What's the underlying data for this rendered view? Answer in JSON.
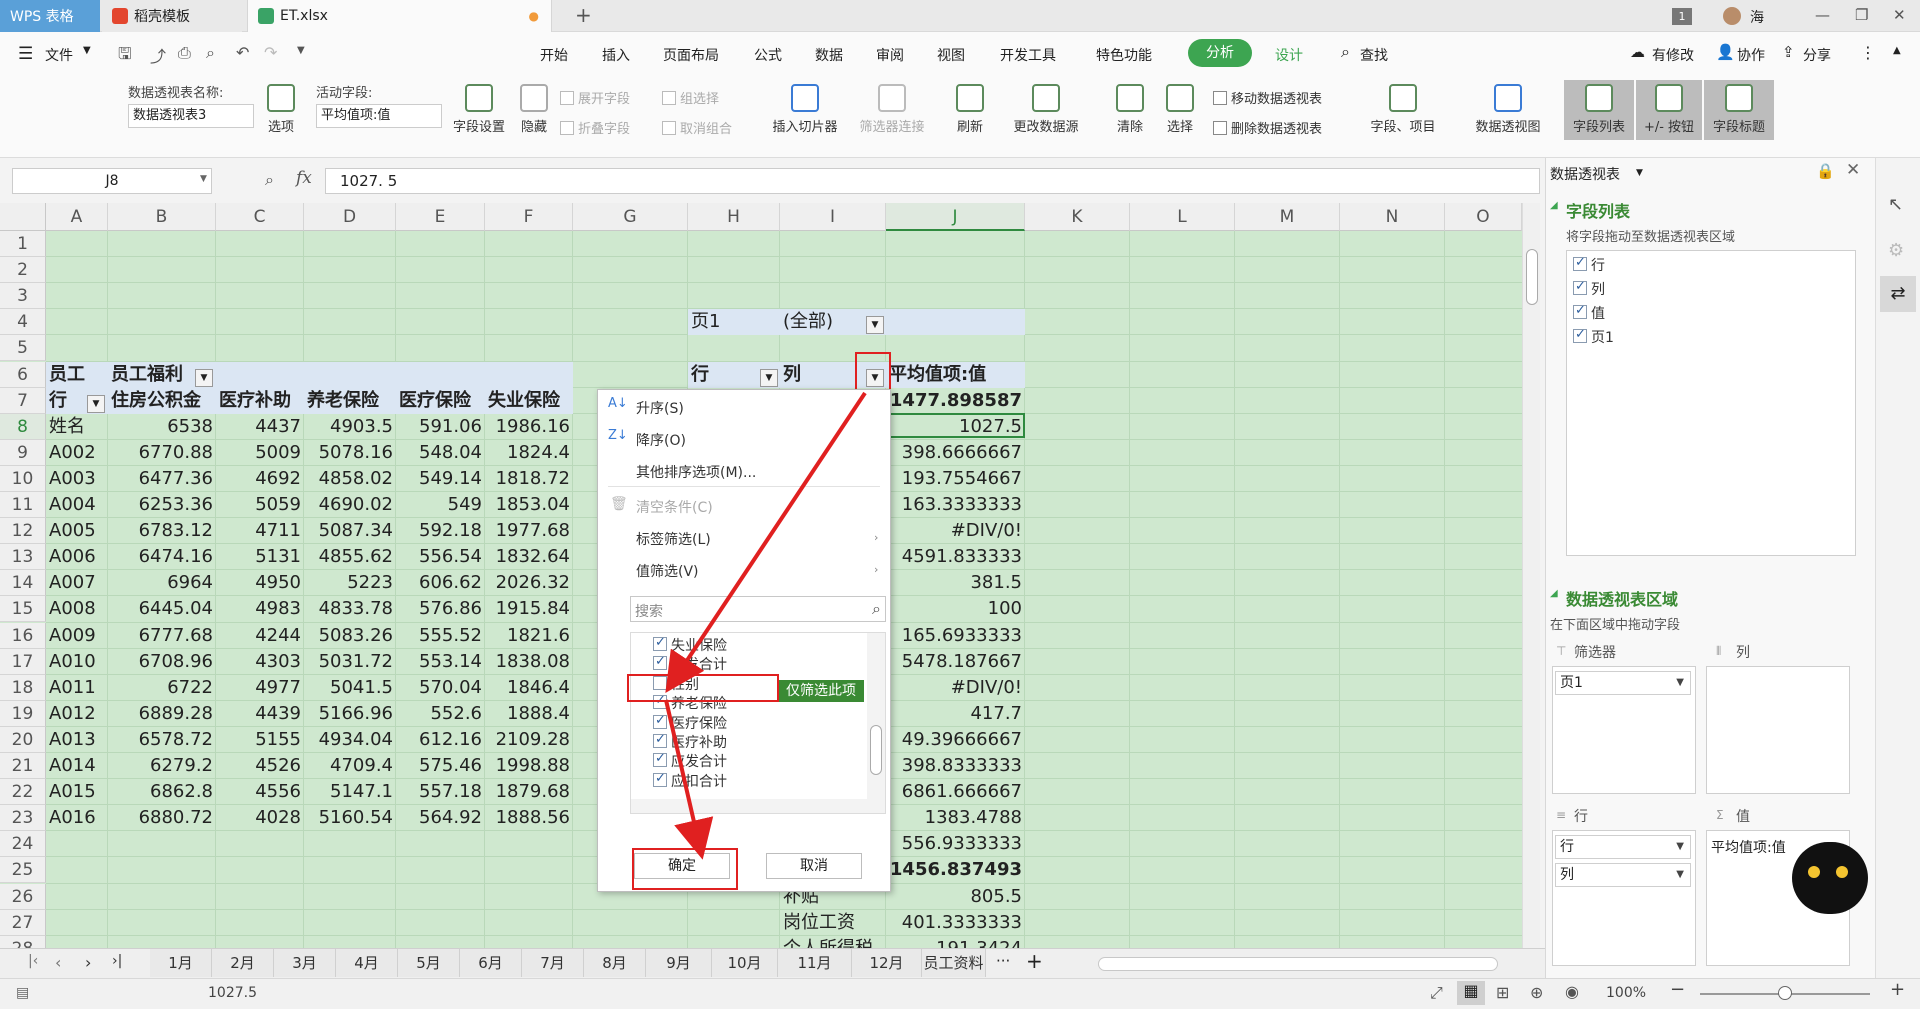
{
  "titlebar": {
    "tabs": [
      "WPS 表格",
      "稻壳模板",
      "ET.xlsx"
    ],
    "badge": "1",
    "user": "海"
  },
  "menubar": {
    "file": "文件",
    "items": [
      "开始",
      "插入",
      "页面布局",
      "公式",
      "数据",
      "审阅",
      "视图",
      "开发工具",
      "特色功能",
      "分析",
      "设计",
      "查找"
    ],
    "right": [
      "有修改",
      "协作",
      "分享"
    ]
  },
  "ribbon": {
    "name_label": "数据透视表名称:",
    "name_value": "数据透视表3",
    "options": "选项",
    "active_label": "活动字段:",
    "active_value": "平均值项:值",
    "field_settings": "字段设置",
    "hide": "隐藏",
    "expand": "展开字段",
    "collapse": "折叠字段",
    "group": "组选择",
    "ungroup": "取消组合",
    "slicer": "插入切片器",
    "filter_conn": "筛选器连接",
    "refresh": "刷新",
    "change_source": "更改数据源",
    "clear": "清除",
    "select": "选择",
    "move": "移动数据透视表",
    "delete": "删除数据透视表",
    "fields_items": "字段、项目",
    "pivot_chart": "数据透视图",
    "field_list": "字段列表",
    "buttons": "+/- 按钮",
    "field_headers": "字段标题"
  },
  "formula": {
    "cellref": "J8",
    "fx": "fx",
    "value": "1027. 5"
  },
  "grid": {
    "columns": [
      "A",
      "B",
      "C",
      "D",
      "E",
      "F",
      "G",
      "H",
      "I",
      "J",
      "K",
      "L",
      "M",
      "N",
      "O"
    ],
    "rows": [
      "1",
      "2",
      "3",
      "4",
      "5",
      "6",
      "7",
      "8",
      "9",
      "10",
      "11",
      "12",
      "13",
      "14",
      "15",
      "16",
      "17",
      "18",
      "19",
      "20",
      "21",
      "22",
      "23",
      "24",
      "25",
      "26",
      "27",
      "28"
    ],
    "page1_label": "页1",
    "page1_value": "(全部)",
    "left_headers": {
      "r6a": "员工",
      "r6b": "员工福利",
      "r7a": "行",
      "r7b": "住房公积金",
      "r7c": "医疗补助",
      "r7d": "养老保险",
      "r7e": "医疗保险",
      "r7f": "失业保险"
    },
    "left_rows": [
      [
        "姓名",
        "6538",
        "4437",
        "4903.5",
        "591.06",
        "1986.16"
      ],
      [
        "A002",
        "6770.88",
        "5009",
        "5078.16",
        "548.04",
        "1824.4"
      ],
      [
        "A003",
        "6477.36",
        "4692",
        "4858.02",
        "549.14",
        "1818.72"
      ],
      [
        "A004",
        "6253.36",
        "5059",
        "4690.02",
        "549",
        "1853.04"
      ],
      [
        "A005",
        "6783.12",
        "4711",
        "5087.34",
        "592.18",
        "1977.68"
      ],
      [
        "A006",
        "6474.16",
        "5131",
        "4855.62",
        "556.54",
        "1832.64"
      ],
      [
        "A007",
        "6964",
        "4950",
        "5223",
        "606.62",
        "2026.32"
      ],
      [
        "A008",
        "6445.04",
        "4983",
        "4833.78",
        "576.86",
        "1915.84"
      ],
      [
        "A009",
        "6777.68",
        "4244",
        "5083.26",
        "555.52",
        "1821.6"
      ],
      [
        "A010",
        "6708.96",
        "4303",
        "5031.72",
        "553.14",
        "1838.08"
      ],
      [
        "A011",
        "6722",
        "4977",
        "5041.5",
        "570.04",
        "1846.4"
      ],
      [
        "A012",
        "6889.28",
        "4439",
        "5166.96",
        "552.6",
        "1888.4"
      ],
      [
        "A013",
        "6578.72",
        "5155",
        "4934.04",
        "612.16",
        "2109.28"
      ],
      [
        "A014",
        "6279.2",
        "4526",
        "4709.4",
        "575.46",
        "1998.88"
      ],
      [
        "A015",
        "6862.8",
        "4556",
        "5147.1",
        "557.18",
        "1879.68"
      ],
      [
        "A016",
        "6880.72",
        "4028",
        "5160.54",
        "564.92",
        "1888.56"
      ]
    ],
    "right_headers": {
      "h": "行",
      "i": "列",
      "j": "平均值项:值"
    },
    "j_values": [
      "1477.898587",
      "1027.5",
      "398.6666667",
      "193.7554667",
      "163.3333333",
      "#DIV/0!",
      "4591.833333",
      "381.5",
      "100",
      "165.6933333",
      "5478.187667",
      "#DIV/0!",
      "417.7",
      "49.39666667",
      "398.8333333",
      "6861.666667",
      "1383.4788",
      "556.9333333",
      "1456.837493",
      "805.5",
      "401.3333333",
      "191.3424"
    ],
    "i_tail": [
      "补贴",
      "岗位工资",
      "个人所得税"
    ]
  },
  "popup": {
    "sort_asc": "升序(S)",
    "sort_desc": "降序(O)",
    "more_sort": "其他排序选项(M)...",
    "clear": "清空条件(C)",
    "label_filter": "标签筛选(L)",
    "value_filter": "值筛选(V)",
    "search_placeholder": "搜索",
    "items": [
      {
        "label": "失业保险",
        "checked": true
      },
      {
        "label": "实发合计",
        "checked": true
      },
      {
        "label": "性别",
        "checked": false
      },
      {
        "label": "养老保险",
        "checked": true
      },
      {
        "label": "医疗保险",
        "checked": true
      },
      {
        "label": "医疗补助",
        "checked": true
      },
      {
        "label": "应发合计",
        "checked": true
      },
      {
        "label": "应扣合计",
        "checked": true
      }
    ],
    "only_this": "仅筛选此项",
    "ok": "确定",
    "cancel": "取消"
  },
  "sheets": [
    "1月",
    "2月",
    "3月",
    "4月",
    "5月",
    "6月",
    "7月",
    "8月",
    "9月",
    "10月",
    "11月",
    "12月",
    "员工资料"
  ],
  "status": {
    "value": "1027.5",
    "zoom": "100%"
  },
  "panel": {
    "title": "数据透视表",
    "field_list_title": "字段列表",
    "field_hint": "将字段拖动至数据透视表区域",
    "fields": [
      {
        "label": "行",
        "checked": true
      },
      {
        "label": "列",
        "checked": true
      },
      {
        "label": "值",
        "checked": true
      },
      {
        "label": "页1",
        "checked": true
      }
    ],
    "area_title": "数据透视表区域",
    "area_hint": "在下面区域中拖动字段",
    "filter_label": "筛选器",
    "col_label": "列",
    "row_label": "行",
    "val_label": "值",
    "filter_item": "页1",
    "row_items": [
      "行",
      "列"
    ],
    "val_item": "平均值项:值"
  }
}
